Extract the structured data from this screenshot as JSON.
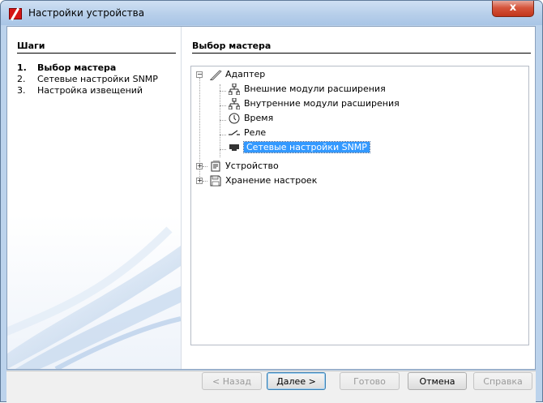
{
  "window": {
    "title": "Настройки устройства",
    "close_label": "x"
  },
  "steps": {
    "title": "Шаги",
    "items": [
      {
        "num": "1.",
        "label": "Выбор мастера",
        "active": true
      },
      {
        "num": "2.",
        "label": "Сетевые настройки SNMP",
        "active": false
      },
      {
        "num": "3.",
        "label": "Настройка извещений",
        "active": false
      }
    ]
  },
  "main": {
    "title": "Выбор мастера",
    "tree": {
      "adapter": {
        "label": "Адаптер",
        "expanded": true,
        "icon": "pen-icon"
      },
      "adapter_children": [
        {
          "label": "Внешние модули расширения",
          "icon": "network-icon"
        },
        {
          "label": "Внутренние модули расширения",
          "icon": "network-icon"
        },
        {
          "label": "Время",
          "icon": "clock-icon"
        },
        {
          "label": "Реле",
          "icon": "relay-icon"
        },
        {
          "label": "Сетевые настройки SNMP",
          "icon": "ethernet-port-icon",
          "selected": true
        }
      ],
      "device": {
        "label": "Устройство",
        "expanded": false,
        "icon": "device-icon"
      },
      "storage": {
        "label": "Хранение настроек",
        "expanded": false,
        "icon": "floppy-disk-icon"
      }
    }
  },
  "buttons": {
    "back": "< Назад",
    "next": "Далее >",
    "finish": "Готово",
    "cancel": "Отмена",
    "help": "Справка"
  },
  "colors": {
    "selection": "#3399ff",
    "title_bar": "#b7cfea",
    "close": "#c2351b"
  }
}
